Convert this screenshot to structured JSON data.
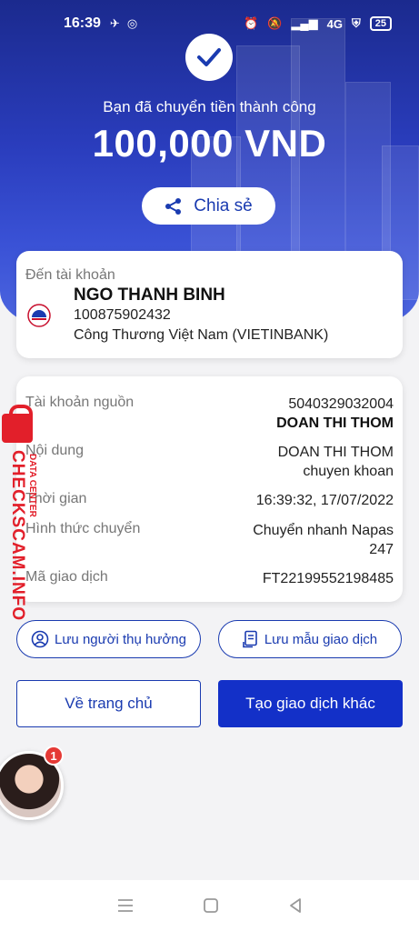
{
  "status_bar": {
    "time": "16:39",
    "network": "4G",
    "battery": "25"
  },
  "success": {
    "message": "Bạn đã chuyển tiền thành công",
    "amount": "100,000 VND",
    "share_label": "Chia sẻ"
  },
  "recipient": {
    "title": "Đến tài khoản",
    "name": "NGO THANH BINH",
    "account": "100875902432",
    "bank": "Công Thương Việt Nam (VIETINBANK)"
  },
  "details": {
    "source_label": "Tài khoản nguồn",
    "source_account": "5040329032004",
    "source_name": "DOAN THI THOM",
    "content_label": "Nội dung",
    "content_line1": "DOAN THI THOM",
    "content_line2": "chuyen khoan",
    "time_label": "Thời gian",
    "time_value": "16:39:32, 17/07/2022",
    "method_label": "Hình thức chuyển",
    "method_line1": "Chuyển nhanh Napas",
    "method_line2": "247",
    "txn_label": "Mã giao dịch",
    "txn_value": "FT22199552198485"
  },
  "actions": {
    "save_recipient": "Lưu người thụ hưởng",
    "save_template": "Lưu mẫu giao dịch",
    "home": "Về trang chủ",
    "new_transaction": "Tạo giao dịch khác"
  },
  "chat_head": {
    "badge": "1"
  },
  "watermark": {
    "text": "CHECKSCAM.INFO",
    "sub": "DATA CENTER"
  },
  "colors": {
    "primary": "#1330c8",
    "accent_text": "#1a3bb0",
    "watermark": "#e21f2a"
  }
}
